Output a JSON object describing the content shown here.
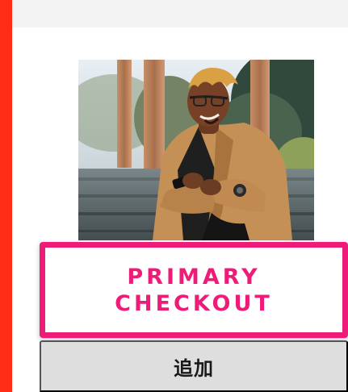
{
  "header": {
    "background_color": "#f3f3f3"
  },
  "accent": {
    "color": "#ff2d14"
  },
  "product_image": {
    "subject": "man-smiling-using-phone",
    "alt": ""
  },
  "buttons": {
    "primary": {
      "line1": "PRIMARY",
      "line2": "CHECKOUT",
      "border_color": "#ee1c78",
      "text_color": "#ee1c78"
    },
    "secondary": {
      "label": "追加",
      "background_color": "#dedede",
      "text_color": "#1a1a1a"
    }
  }
}
